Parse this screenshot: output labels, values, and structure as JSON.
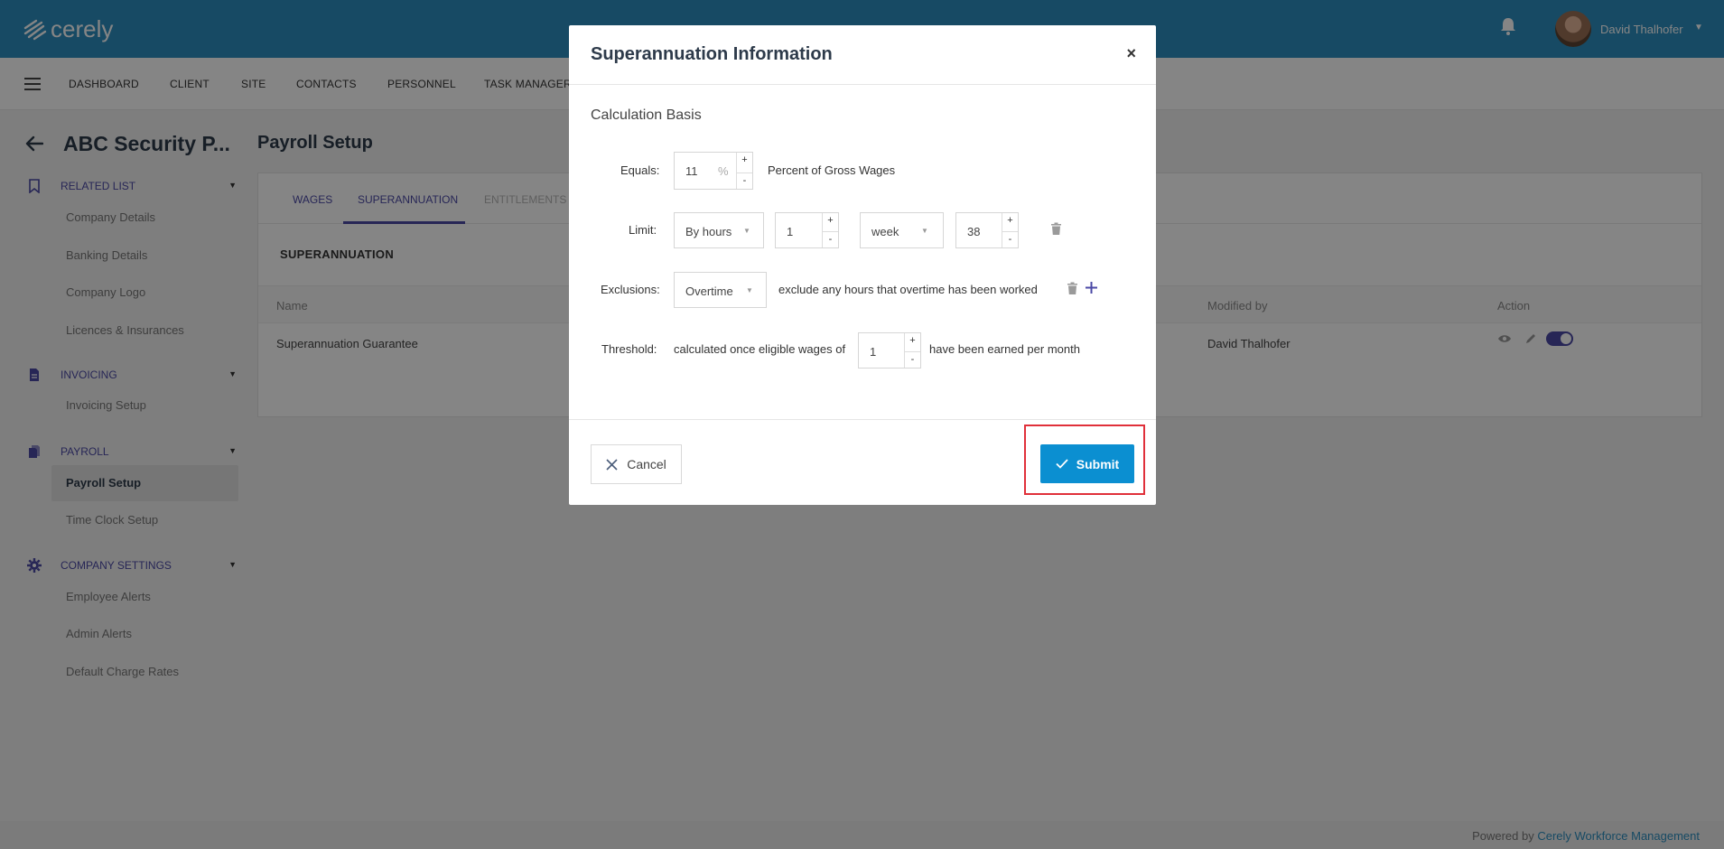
{
  "app": {
    "logo_text": "cerely"
  },
  "user": {
    "name": "David Thalhofer"
  },
  "nav": {
    "items": [
      "DASHBOARD",
      "CLIENT",
      "SITE",
      "CONTACTS",
      "PERSONNEL",
      "TASK MANAGER"
    ]
  },
  "header": {
    "company_title": "ABC Security P...",
    "page_title": "Payroll Setup"
  },
  "sidebar": {
    "sections": [
      {
        "label": "RELATED LIST",
        "items": [
          "Company Details",
          "Banking Details",
          "Company Logo",
          "Licences & Insurances"
        ]
      },
      {
        "label": "INVOICING",
        "items": [
          "Invoicing Setup"
        ]
      },
      {
        "label": "PAYROLL",
        "items": [
          "Payroll Setup",
          "Time Clock Setup"
        ]
      },
      {
        "label": "COMPANY SETTINGS",
        "items": [
          "Employee Alerts",
          "Admin Alerts",
          "Default Charge Rates"
        ]
      }
    ],
    "active_item": "Payroll Setup"
  },
  "tabs": [
    {
      "label": "WAGES",
      "state": "normal"
    },
    {
      "label": "SUPERANNUATION",
      "state": "active"
    },
    {
      "label": "ENTITLEMENTS",
      "state": "disabled"
    }
  ],
  "card": {
    "heading": "SUPERANNUATION",
    "columns": [
      "Name",
      "Modified by",
      "Action"
    ],
    "rows": [
      {
        "name": "Superannuation Guarantee",
        "modified_by": "David Thalhofer"
      }
    ]
  },
  "modal": {
    "title": "Superannuation Information",
    "close_label": "×",
    "section_title": "Calculation Basis",
    "equals": {
      "label": "Equals:",
      "value": "11",
      "unit": "%",
      "suffix": "Percent of Gross Wages"
    },
    "limit": {
      "label": "Limit:",
      "type": "By hours",
      "count": "1",
      "period": "week",
      "hours": "38"
    },
    "exclusions": {
      "label": "Exclusions:",
      "value": "Overtime",
      "description": "exclude any hours that overtime has been worked"
    },
    "threshold": {
      "label": "Threshold:",
      "prefix": "calculated once eligible wages of",
      "value": "1",
      "suffix": "have been earned per month"
    },
    "cancel_label": "Cancel",
    "submit_label": "Submit"
  },
  "footer": {
    "prefix": "Powered by ",
    "link": "Cerely Workforce Management"
  },
  "colors": {
    "brand": "#2c8fc0",
    "accent": "#4b49a6",
    "submit": "#0b8fd1",
    "highlight": "#e0303a"
  }
}
